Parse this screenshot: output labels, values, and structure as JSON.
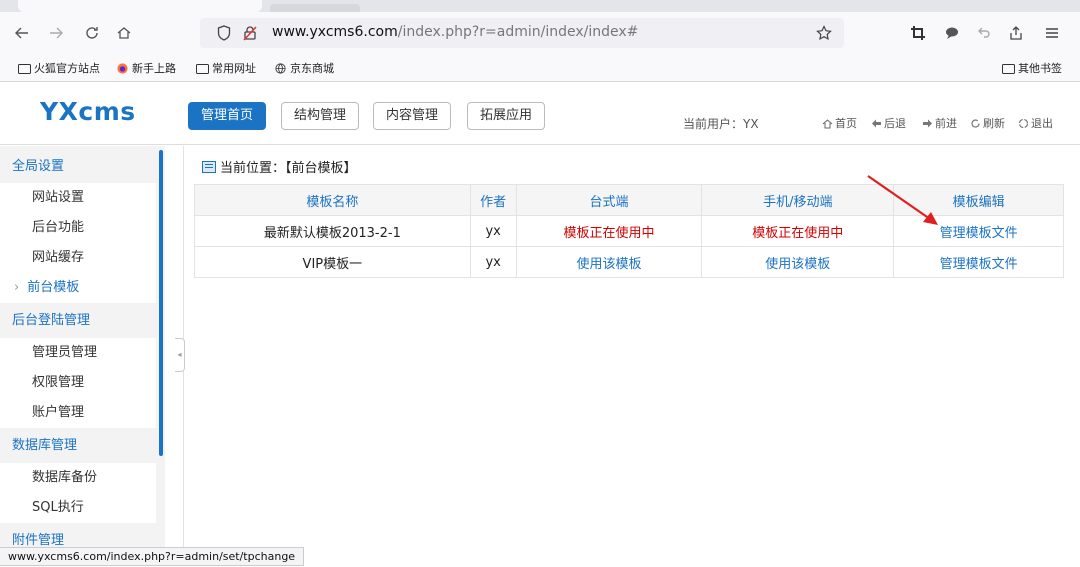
{
  "browser": {
    "url_host": "www.yxcms6.com",
    "url_path": "/index.php?r=admin/index/index#",
    "bookmarks": [
      "火狐官方站点",
      "新手上路",
      "常用网址",
      "京东商城"
    ],
    "other_bookmarks": "其他书签"
  },
  "header": {
    "logo": "YXcms",
    "nav": [
      "管理首页",
      "结构管理",
      "内容管理",
      "拓展应用"
    ],
    "current_user": "当前用户：YX",
    "quick_links": [
      "首页",
      "后退",
      "前进",
      "刷新",
      "退出"
    ]
  },
  "sidebar": {
    "sections": [
      {
        "title": "全局设置",
        "items": [
          "网站设置",
          "后台功能",
          "网站缓存",
          "前台模板"
        ]
      },
      {
        "title": "后台登陆管理",
        "items": [
          "管理员管理",
          "权限管理",
          "账户管理"
        ]
      },
      {
        "title": "数据库管理",
        "items": [
          "数据库备份",
          "SQL执行"
        ]
      },
      {
        "title": "附件管理",
        "items": []
      }
    ],
    "current_item": "前台模板"
  },
  "main": {
    "breadcrumb": "当前位置：【前台模板】",
    "table": {
      "headers": [
        "模板名称",
        "作者",
        "台式端",
        "手机/移动端",
        "模板编辑"
      ],
      "rows": [
        [
          "最新默认模板2013-2-1",
          "yx",
          "模板正在使用中",
          "模板正在使用中",
          "管理模板文件"
        ],
        [
          "VIP模板一",
          "yx",
          "使用该模板",
          "使用该模板",
          "管理模板文件"
        ]
      ]
    }
  },
  "status_bar": "www.yxcms6.com/index.php?r=admin/set/tpchange",
  "colors": {
    "accent": "#1b73c4",
    "active_text": "#d40000",
    "annotation_arrow": "#e02020"
  }
}
